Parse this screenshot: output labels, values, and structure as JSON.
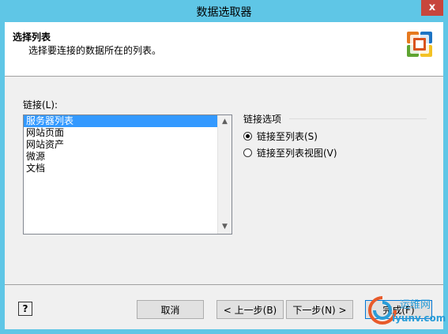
{
  "window": {
    "title": "数据选取器",
    "close_glyph": "x"
  },
  "header": {
    "title": "选择列表",
    "subtitle": "选择要连接的数据所在的列表。"
  },
  "link": {
    "label": "链接(L):",
    "items": [
      "服务器列表",
      "网站页面",
      "网站资产",
      "微源",
      "文档"
    ],
    "selected_index": 0
  },
  "options": {
    "title": "链接选项",
    "radio_list": {
      "label": "链接至列表(S)",
      "checked": true
    },
    "radio_view": {
      "label": "链接至列表视图(V)",
      "checked": false
    }
  },
  "footer": {
    "help_glyph": "?",
    "cancel": "取消",
    "back": "< 上一步(B)",
    "next": "下一步(N) >",
    "finish": "完成(F)"
  },
  "watermark": {
    "line1": "运维网",
    "line2": "iyunv.com"
  },
  "colors": {
    "titlebar": "#5fc6e6",
    "selection": "#3399ff",
    "close": "#c7463c"
  }
}
